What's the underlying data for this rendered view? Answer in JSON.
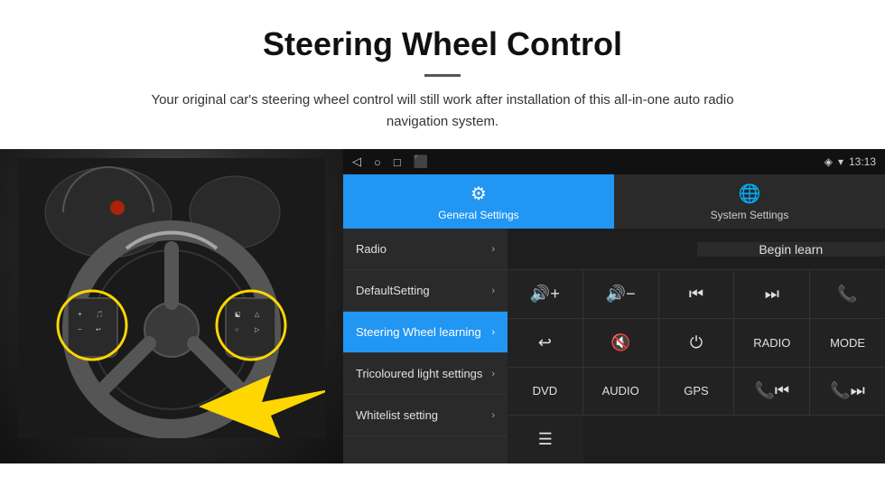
{
  "header": {
    "title": "Steering Wheel Control",
    "subtitle": "Your original car's steering wheel control will still work after installation of this all-in-one auto radio navigation system."
  },
  "statusBar": {
    "time": "13:13",
    "icons": [
      "◁",
      "○",
      "□",
      "⬛"
    ]
  },
  "tabs": {
    "general": {
      "label": "General Settings",
      "active": true
    },
    "system": {
      "label": "System Settings",
      "active": false
    }
  },
  "menu": {
    "items": [
      {
        "label": "Radio",
        "active": false
      },
      {
        "label": "DefaultSetting",
        "active": false
      },
      {
        "label": "Steering Wheel learning",
        "active": true
      },
      {
        "label": "Tricoloured light settings",
        "active": false
      },
      {
        "label": "Whitelist setting",
        "active": false
      }
    ]
  },
  "controlPanel": {
    "beginLearnLabel": "Begin learn",
    "rows": [
      [
        {
          "label": "🔊+",
          "type": "icon"
        },
        {
          "label": "🔊−",
          "type": "icon"
        },
        {
          "label": "⏮",
          "type": "icon"
        },
        {
          "label": "⏭",
          "type": "icon"
        },
        {
          "label": "📞",
          "type": "icon"
        }
      ],
      [
        {
          "label": "↩",
          "type": "icon"
        },
        {
          "label": "🔇×",
          "type": "icon"
        },
        {
          "label": "⏻",
          "type": "icon"
        },
        {
          "label": "RADIO",
          "type": "text"
        },
        {
          "label": "MODE",
          "type": "text"
        }
      ],
      [
        {
          "label": "DVD",
          "type": "text"
        },
        {
          "label": "AUDIO",
          "type": "text"
        },
        {
          "label": "GPS",
          "type": "text"
        },
        {
          "label": "📞⏮",
          "type": "icon"
        },
        {
          "label": "📞⏭",
          "type": "icon"
        }
      ],
      [
        {
          "label": "≡",
          "type": "icon"
        }
      ]
    ]
  }
}
